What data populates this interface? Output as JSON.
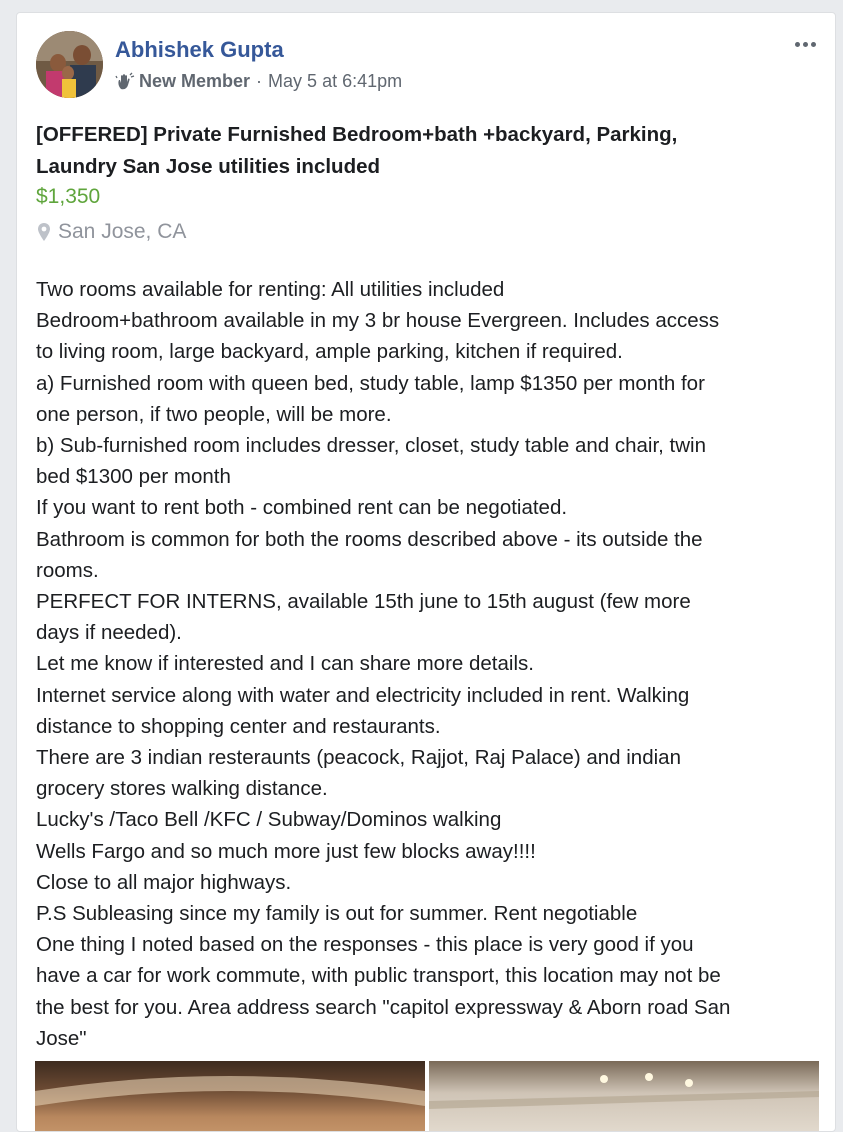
{
  "author": {
    "name": "Abhishek Gupta",
    "badge": "New Member",
    "separator": "·",
    "timestamp": "May 5 at 6:41pm"
  },
  "post": {
    "title_lines": [
      "[OFFERED] Private Furnished Bedroom+bath +backyard, Parking,",
      "Laundry San Jose utilities included"
    ],
    "price": "$1,350",
    "location": "San Jose, CA",
    "body_lines": [
      "Two rooms available for renting: All utilities included",
      "Bedroom+bathroom available in my 3 br house Evergreen. Includes access",
      "to living room, large backyard, ample parking, kitchen if required.",
      "a) Furnished room with queen bed, study table, lamp $1350 per month for",
      "one person, if two people, will be more.",
      "b) Sub-furnished room includes dresser, closet, study table and chair, twin",
      "bed $1300 per month",
      "If you want to rent both - combined rent can be negotiated.",
      "Bathroom is common for both the rooms described above - its outside the",
      "rooms.",
      "PERFECT FOR INTERNS, available 15th june to 15th august (few more",
      "days if needed).",
      "Let me know if interested and I can share more details.",
      "Internet service along with water and electricity included in rent. Walking",
      "distance to shopping center and restaurants.",
      "There are 3 indian resteraunts (peacock, Rajjot, Raj Palace) and indian",
      "grocery stores walking distance.",
      "Lucky's /Taco Bell /KFC / Subway/Dominos walking",
      "Wells Fargo and so much more just few blocks away!!!!",
      "Close to all major highways.",
      "P.S Subleasing since my family is out for summer. Rent negotiable",
      "One thing I noted based on the responses - this place is very good if you",
      "have a car for work commute, with public transport, this location may not be",
      "the best for you. Area address search \"capitol expressway & Aborn road San",
      "Jose\""
    ]
  },
  "icons": {
    "member": "new-member-hand-icon",
    "location": "map-pin-icon",
    "more": "more-options-icon"
  },
  "colors": {
    "author_name": "#365899",
    "price": "#5fa53c",
    "muted": "#90949c",
    "background": "#e9ebee"
  }
}
